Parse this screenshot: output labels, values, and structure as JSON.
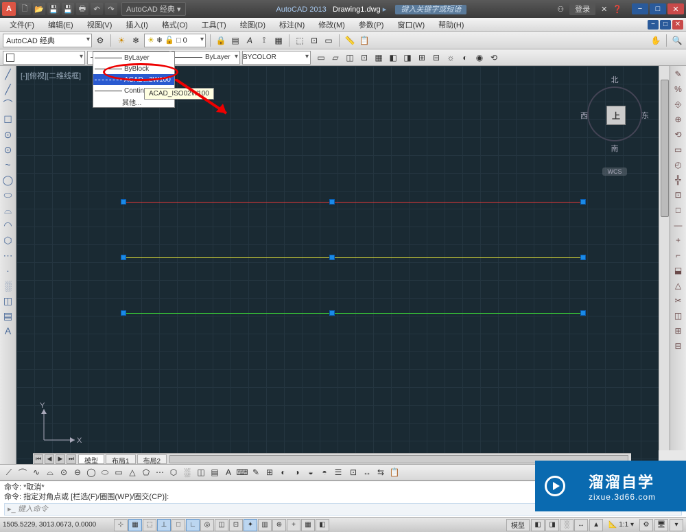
{
  "titlebar": {
    "logo": "A",
    "workspace_title": "AutoCAD 经典",
    "app_title": "AutoCAD 2013",
    "file_title": "Drawing1.dwg",
    "search_placeholder": "键入关键字或短语",
    "login": "登录"
  },
  "menu": {
    "items": [
      "文件(F)",
      "编辑(E)",
      "视图(V)",
      "插入(I)",
      "格式(O)",
      "工具(T)",
      "绘图(D)",
      "标注(N)",
      "修改(M)",
      "参数(P)",
      "窗口(W)",
      "帮助(H)"
    ]
  },
  "toolbar": {
    "workspace_selector": "AutoCAD 经典",
    "layer_state": "0"
  },
  "properties": {
    "color_combo": "",
    "linetype_selected": "ACAD...02W100",
    "lineweight": "ByLayer",
    "plotstyle": "BYCOLOR"
  },
  "linetype_dropdown": {
    "items": [
      "ByLayer",
      "ByBlock",
      "ACAD...2W100",
      "Continuous",
      "其他..."
    ],
    "highlighted_index": 2,
    "tooltip": "ACAD_ISO02W100"
  },
  "viewport_label": "[-][俯视][二维线框]",
  "viewcube": {
    "n": "北",
    "e": "东",
    "s": "南",
    "w": "西",
    "top": "上",
    "wcs": "WCS"
  },
  "ucs": {
    "x": "X",
    "y": "Y"
  },
  "layout_tabs": {
    "tabs": [
      "模型",
      "布局1",
      "布局2"
    ],
    "active": 0
  },
  "cmd": {
    "line1": "命令: *取消*",
    "line2": "命令: 指定对角点或 [栏选(F)/圈围(WP)/圈交(CP)]:",
    "prompt_placeholder": "键入命令"
  },
  "statusbar": {
    "coords": "1505.5229, 3013.0673, 0.0000",
    "model": "模型",
    "scale": "1:1"
  },
  "watermark": {
    "line1": "溜溜自学",
    "line2": "zixue.3d66.com"
  },
  "left_tool_icons": [
    "╱",
    "╱",
    "⌒",
    "☐",
    "⊙",
    "⊙",
    "~",
    "◯",
    "⬭",
    "⌓",
    "◠",
    "⬡",
    "⋯",
    "·",
    "░",
    "◫",
    "▤",
    "A"
  ],
  "right_tool_icons": [
    "✎",
    "%",
    "⎆",
    "⊕",
    "⟲",
    "▭",
    "◴",
    "╬",
    "⊡",
    "□",
    "—",
    "+",
    "⌐",
    "⬓",
    "△",
    "✂",
    "◫",
    "⊞",
    "⊟"
  ],
  "status_buttons": [
    "⊹",
    "▦",
    "⬚",
    "⊥",
    "□",
    "∟",
    "◎",
    "◫",
    "⊡",
    "✦",
    "▥",
    "⊕",
    "+",
    "▦",
    "◧"
  ],
  "right_status": [
    "◧",
    "◨",
    "░",
    "↔"
  ]
}
